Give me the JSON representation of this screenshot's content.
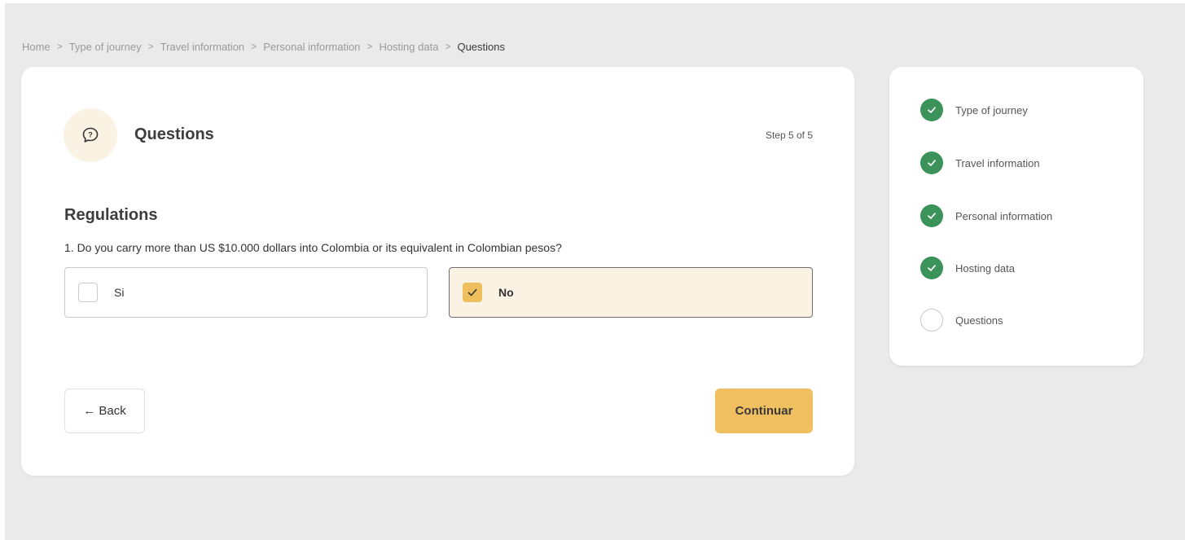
{
  "breadcrumb": [
    {
      "label": "Home"
    },
    {
      "label": "Type of journey"
    },
    {
      "label": "Travel information"
    },
    {
      "label": "Personal information"
    },
    {
      "label": "Hosting data"
    },
    {
      "label": "Questions",
      "current": true
    }
  ],
  "header": {
    "icon": "question-bubble-icon",
    "title": "Questions",
    "step_indicator": "Step 5 of 5"
  },
  "section": {
    "title": "Regulations",
    "question": "1. Do you carry more than US $10.000 dollars into Colombia or its equivalent in Colombian pesos?",
    "options": [
      {
        "label": "Si",
        "checked": false
      },
      {
        "label": "No",
        "checked": true
      }
    ]
  },
  "actions": {
    "back_label": "← Back",
    "continue_label": "Continuar"
  },
  "steps": [
    {
      "label": "Type of journey",
      "completed": true
    },
    {
      "label": "Travel information",
      "completed": true
    },
    {
      "label": "Personal information",
      "completed": true
    },
    {
      "label": "Hosting data",
      "completed": true
    },
    {
      "label": "Questions",
      "completed": false
    }
  ],
  "colors": {
    "accent": "#F0C060",
    "accent_light": "#FAF3E4",
    "success": "#3B9359",
    "background": "#EAEAEA"
  }
}
